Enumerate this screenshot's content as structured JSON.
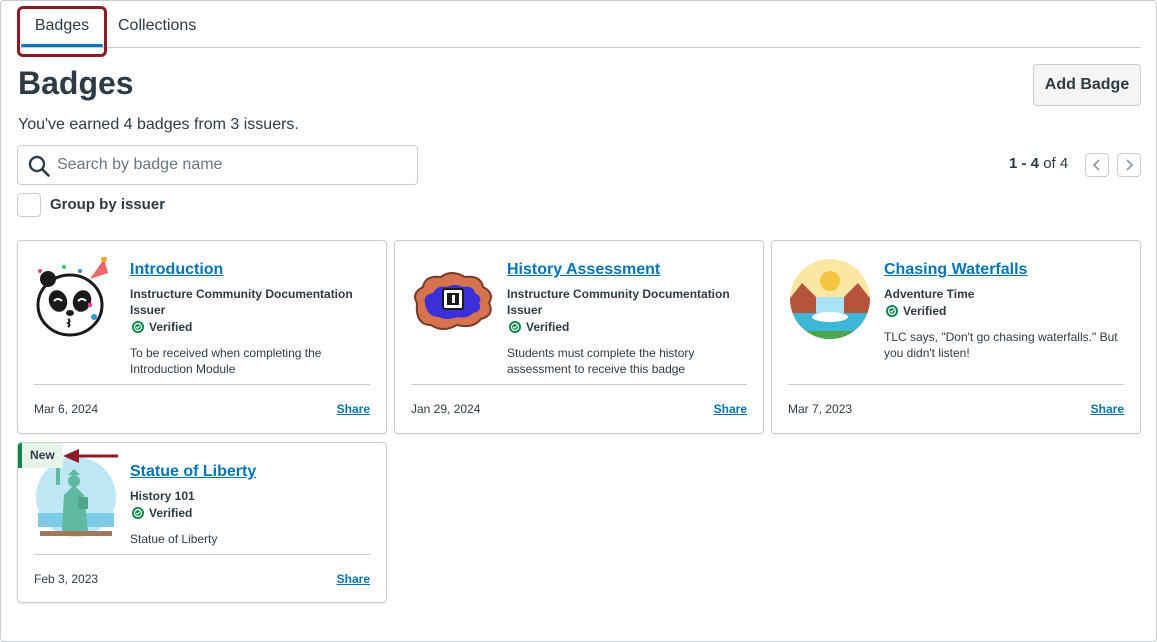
{
  "tabs": [
    {
      "label": "Badges",
      "active": true
    },
    {
      "label": "Collections",
      "active": false
    }
  ],
  "page": {
    "title": "Badges",
    "add_button": "Add Badge",
    "summary": "You've earned 4 badges from 3 issuers."
  },
  "search": {
    "placeholder": "Search by badge name",
    "value": ""
  },
  "pagination": {
    "range": "1 - 4",
    "of_label": "of 4"
  },
  "group_by": {
    "label": "Group by issuer",
    "checked": false
  },
  "verified_label": "Verified",
  "share_label": "Share",
  "new_label": "New",
  "badges": [
    {
      "name": "Introduction",
      "issuer": "Instructure Community Documentation Issuer",
      "description": "To be received when completing the Introduction Module",
      "date": "Mar 6, 2024",
      "icon": "panda-party-icon"
    },
    {
      "name": "History Assessment",
      "issuer": "Instructure Community Documentation Issuer",
      "description": "Students must complete the history assessment to receive this badge",
      "date": "Jan 29, 2024",
      "icon": "history-cloud-icon"
    },
    {
      "name": "Chasing Waterfalls",
      "issuer": "Adventure Time",
      "description": "TLC says, \"Don't go chasing waterfalls.\" But you didn't listen!",
      "date": "Mar 7, 2023",
      "icon": "waterfall-icon"
    },
    {
      "name": "Statue of Liberty",
      "issuer": "History 101",
      "description": "Statue of Liberty",
      "date": "Feb 3, 2023",
      "icon": "statue-of-liberty-icon",
      "is_new": true
    }
  ],
  "colors": {
    "link": "#0374b5",
    "text": "#2d3b45",
    "border": "#c7cdd1",
    "verified": "#0b874b",
    "callout": "#8c1b26"
  }
}
